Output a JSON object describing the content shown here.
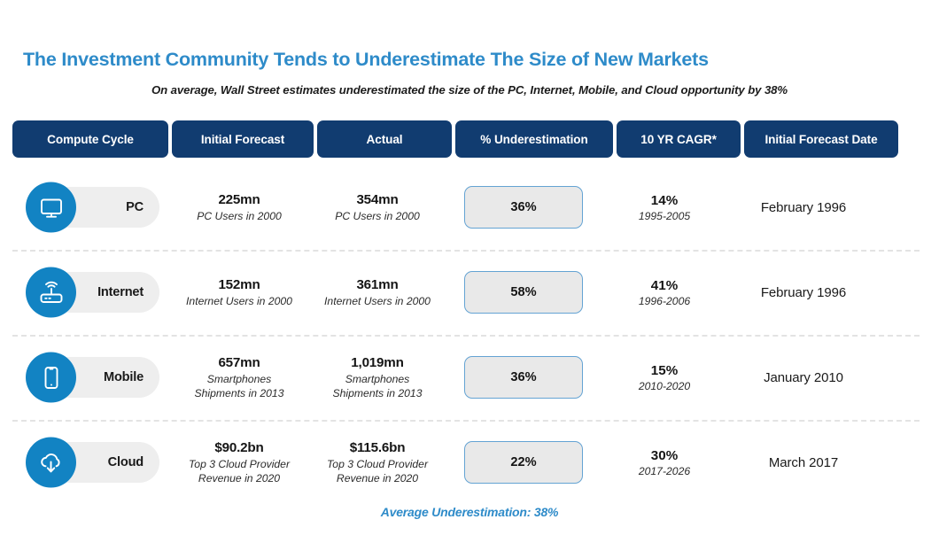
{
  "header": {
    "title": "The Investment Community Tends to Underestimate The Size of New Markets",
    "subtitle": "On average, Wall Street estimates underestimated the size of the PC, Internet, Mobile, and Cloud opportunity by 38%"
  },
  "table": {
    "columns": [
      "Compute Cycle",
      "Initial Forecast",
      "Actual",
      "% Underestimation",
      "10 YR CAGR*",
      "Initial Forecast Date"
    ],
    "rows": [
      {
        "cycle": "PC",
        "icon": "desktop-monitor-icon",
        "forecast_value": "225mn",
        "forecast_sub": "PC Users in 2000",
        "actual_value": "354mn",
        "actual_sub": "PC Users in 2000",
        "underestimation": "36%",
        "cagr_value": "14%",
        "cagr_period": "1995-2005",
        "forecast_date": "February 1996"
      },
      {
        "cycle": "Internet",
        "icon": "wifi-router-icon",
        "forecast_value": "152mn",
        "forecast_sub": "Internet Users in 2000",
        "actual_value": "361mn",
        "actual_sub": "Internet Users in 2000",
        "underestimation": "58%",
        "cagr_value": "41%",
        "cagr_period": "1996-2006",
        "forecast_date": "February 1996"
      },
      {
        "cycle": "Mobile",
        "icon": "smartphone-icon",
        "forecast_value": "657mn",
        "forecast_sub": "Smartphones\nShipments in 2013",
        "actual_value": "1,019mn",
        "actual_sub": "Smartphones\nShipments in 2013",
        "underestimation": "36%",
        "cagr_value": "15%",
        "cagr_period": "2010-2020",
        "forecast_date": "January 2010"
      },
      {
        "cycle": "Cloud",
        "icon": "cloud-download-icon",
        "forecast_value": "$90.2bn",
        "forecast_sub": "Top 3 Cloud Provider\nRevenue in 2020",
        "actual_value": "$115.6bn",
        "actual_sub": "Top 3 Cloud Provider\nRevenue in 2020",
        "underestimation": "22%",
        "cagr_value": "30%",
        "cagr_period": "2017-2026",
        "forecast_date": "March 2017"
      }
    ]
  },
  "footer": {
    "average": "Average Underestimation: 38%"
  },
  "colors": {
    "title_blue": "#2e8bc9",
    "header_navy": "#113c70",
    "icon_blue": "#1283c3",
    "badge_fill": "#e9e9e9",
    "badge_border": "#64a3d3",
    "pill_gray": "#eeeeee"
  }
}
